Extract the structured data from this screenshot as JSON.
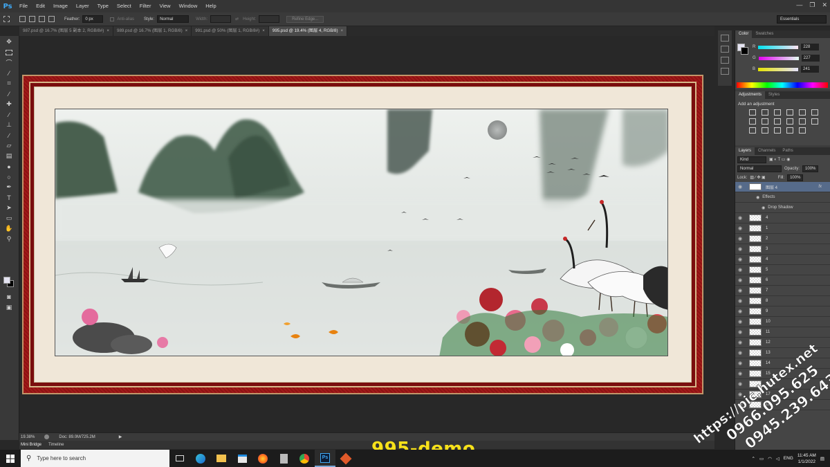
{
  "app": {
    "logo": "Ps"
  },
  "menu": [
    "File",
    "Edit",
    "Image",
    "Layer",
    "Type",
    "Select",
    "Filter",
    "View",
    "Window",
    "Help"
  ],
  "window_controls": [
    "—",
    "❐",
    "✕"
  ],
  "options": {
    "feather_label": "Feather:",
    "feather_value": "0 px",
    "antialias_label": "Anti-alias",
    "style_label": "Style:",
    "style_value": "Normal",
    "width_label": "Width:",
    "height_label": "Height:",
    "refine_label": "Refine Edge...",
    "workspace": "Essentials"
  },
  "tabs": [
    {
      "label": "987.psd @ 16.7% (图层 5 副本 2, RGB/8#)",
      "close": "×"
    },
    {
      "label": "989.psd @ 16.7% (图层 1, RGB/8)",
      "close": "×"
    },
    {
      "label": "991.psd @ 50% (图层 1, RGB/8#)",
      "close": "×"
    },
    {
      "label": "995.psd @ 19.4% (图层 4, RGB/8)",
      "close": "×"
    }
  ],
  "status": {
    "zoom": "19.38%",
    "doc": "Doc: 89.0M/725.2M"
  },
  "bottom_tabs": [
    "Mini Bridge",
    "Timeline"
  ],
  "watermark_demo": "995-demo",
  "watermark_side": [
    "https://pic.hutex.net",
    "0966.095.625",
    "0945.239.643"
  ],
  "color_panel": {
    "tabs": [
      "Color",
      "Swatches"
    ],
    "r_label": "R",
    "r": "228",
    "g_label": "G",
    "g": "227",
    "b_label": "B",
    "b": "241",
    "fg_color": "#e4e3f1"
  },
  "adjustments": {
    "tabs": [
      "Adjustments",
      "Styles"
    ],
    "title": "Add an adjustment"
  },
  "layers": {
    "tabs": [
      "Layers",
      "Channels",
      "Paths"
    ],
    "kind": "Kind",
    "blend": "Normal",
    "opacity_label": "Opacity:",
    "opacity": "100%",
    "lock_label": "Lock:",
    "fill_label": "Fill:",
    "fill": "100%",
    "selected": {
      "name": "图层 4",
      "fx": "fx"
    },
    "effects_label": "Effects",
    "drop_shadow": "Drop Shadow",
    "items": [
      "4",
      "1",
      "2",
      "3",
      "4",
      "5",
      "6",
      "7",
      "8",
      "9",
      "10",
      "11",
      "12",
      "13",
      "14",
      "15",
      "16",
      "17",
      "18"
    ]
  },
  "taskbar": {
    "search_placeholder": "Type here to search",
    "lang": "ENG",
    "time": "11:45 AM",
    "date": "1/1/2022"
  }
}
